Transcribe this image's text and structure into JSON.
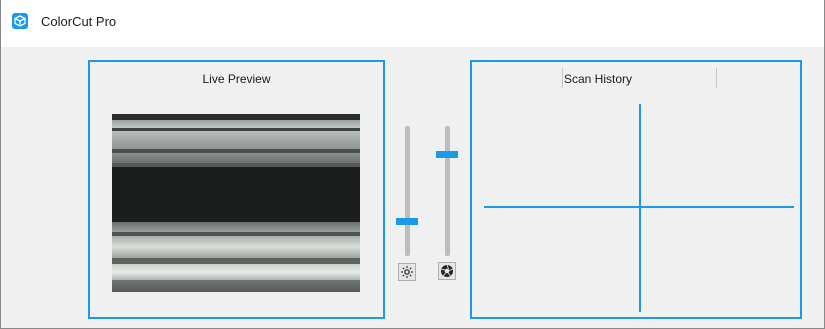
{
  "window": {
    "title": "ColorCut Pro",
    "icon": "cube-icon"
  },
  "preview": {
    "title": "Live Preview"
  },
  "history": {
    "title": "Scan History"
  },
  "controls": {
    "brightness": {
      "icon": "brightness-icon",
      "level": 0.25
    },
    "exposure": {
      "icon": "aperture-icon",
      "level": 0.8
    }
  },
  "colors": {
    "accent": "#1a9bea",
    "background": "#f0f0f0"
  }
}
